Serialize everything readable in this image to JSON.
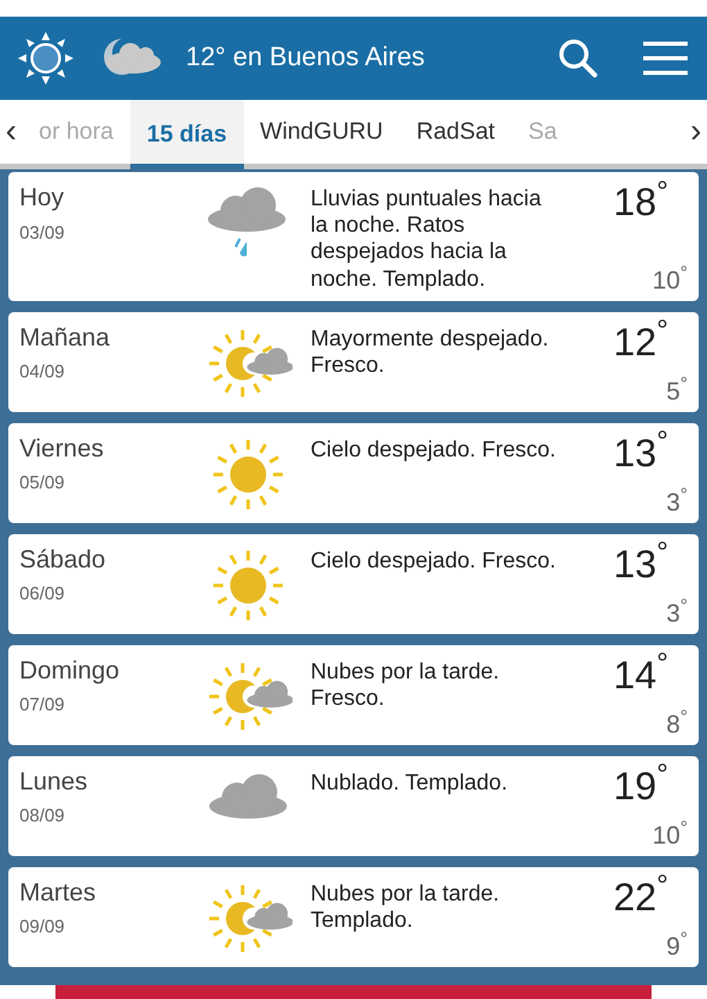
{
  "header": {
    "title": "12° en Buenos Aires"
  },
  "tabs": {
    "prev": "‹",
    "next": "›",
    "items": [
      {
        "label": "or hora",
        "selected": false,
        "faded": true
      },
      {
        "label": "15 días",
        "selected": true,
        "faded": false
      },
      {
        "label": "WindGURU",
        "selected": false,
        "faded": false
      },
      {
        "label": "RadSat",
        "selected": false,
        "faded": false
      },
      {
        "label": "Sa",
        "selected": false,
        "faded": true
      }
    ]
  },
  "days": [
    {
      "day": "Hoy",
      "date": "03/09",
      "kind": "rain",
      "summary": "Lluvias puntuales hacia la noche. Ratos despejados hacia la noche. Templado.",
      "max": "18$^{°}$",
      "min": "10$^{°}$"
    },
    {
      "day": "Mañana",
      "date": "04/09",
      "kind": "sun_cloud",
      "summary": "Mayormente despejado. Fresco.",
      "max": "12$^{°}$",
      "min": "5$^{°}$"
    },
    {
      "day": "Viernes",
      "date": "05/09",
      "kind": "sun",
      "summary": "Cielo despejado. Fresco.",
      "max": "13$^{°}$",
      "min": "3$^{°}$"
    },
    {
      "day": "Sábado",
      "date": "06/09",
      "kind": "sun",
      "summary": "Cielo despejado. Fresco.",
      "max": "13$^{°}$",
      "min": "3$^{°}$"
    },
    {
      "day": "Domingo",
      "date": "07/09",
      "kind": "sun_cloud",
      "summary": "Nubes por la tarde. Fresco.",
      "max": "14$^{°}$",
      "min": "8$^{°}$"
    },
    {
      "day": "Lunes",
      "date": "08/09",
      "kind": "cloud",
      "summary": "Nublado. Templado.",
      "max": "19$^{°}$",
      "min": "10$^{°}$"
    },
    {
      "day": "Martes",
      "date": "09/09",
      "kind": "sun_cloud",
      "summary": "Nubes por la tarde. Templado.",
      "max": "22$^{°}$",
      "min": "9$^{°}$"
    }
  ]
}
